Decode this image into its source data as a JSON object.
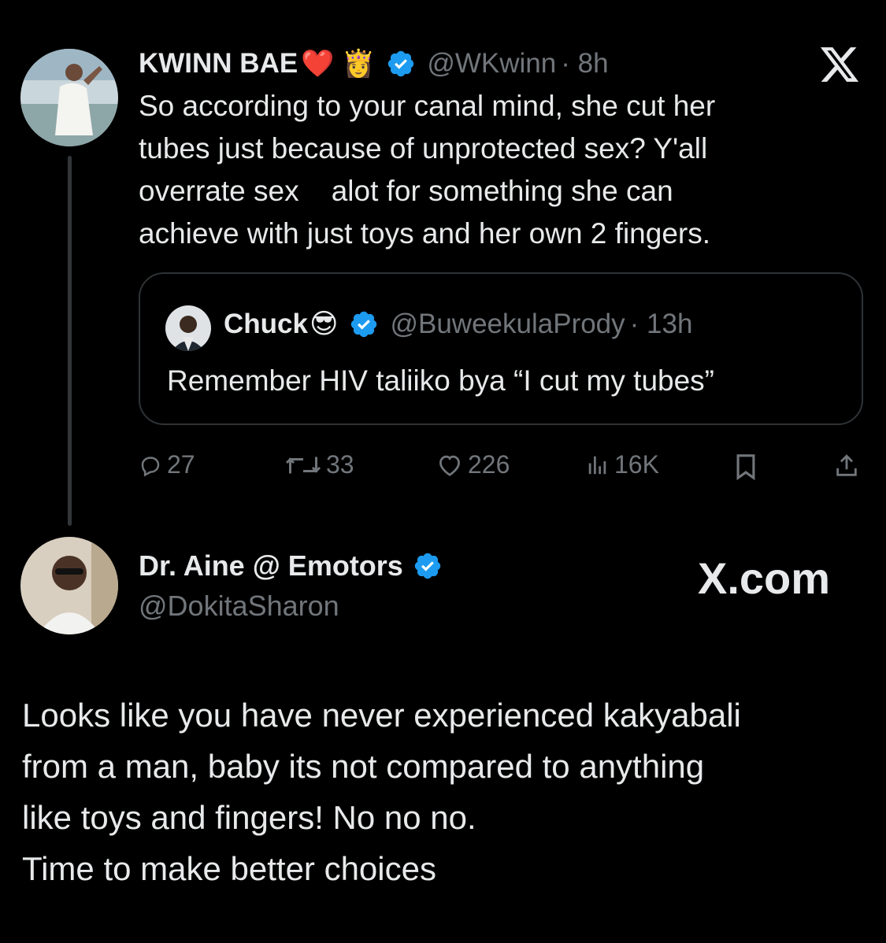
{
  "main_tweet": {
    "author_name": "KWINN BAE",
    "emoji": "❤️ 👸",
    "handle": "@WKwinn",
    "time": "· 8h",
    "text": "So according to your canal mind, she cut her\ntubes just because of unprotected sex? Y'all\noverrate sex    alot for something she can\nachieve with just toys and her own 2 fingers.",
    "logo": "X"
  },
  "quoted_tweet": {
    "author_name": "Chuck",
    "emoji": "😎",
    "handle": "@BuweekulaPrody",
    "time": "· 13h",
    "text": "Remember HIV taliiko bya “I cut my tubes”"
  },
  "actions": {
    "replies": "27",
    "reposts": "33",
    "likes": "226",
    "views": "16K"
  },
  "reply_tweet": {
    "author_name": "Dr. Aine @ Emotors",
    "handle": "@DokitaSharon",
    "watermark": "X.com",
    "text": "Looks like you have never experienced kakyabali\nfrom a man, baby its not compared to anything\nlike toys and fingers! No no no.\nTime to make better choices"
  },
  "colors": {
    "background": "#000000",
    "text": "#e7e9ea",
    "muted": "#71767b",
    "verified": "#1d9bf0",
    "border": "#2f3336"
  },
  "icons": [
    "verified-badge-icon",
    "x-logo-icon",
    "reply-icon",
    "repost-icon",
    "like-icon",
    "views-icon",
    "bookmark-icon",
    "share-icon"
  ]
}
